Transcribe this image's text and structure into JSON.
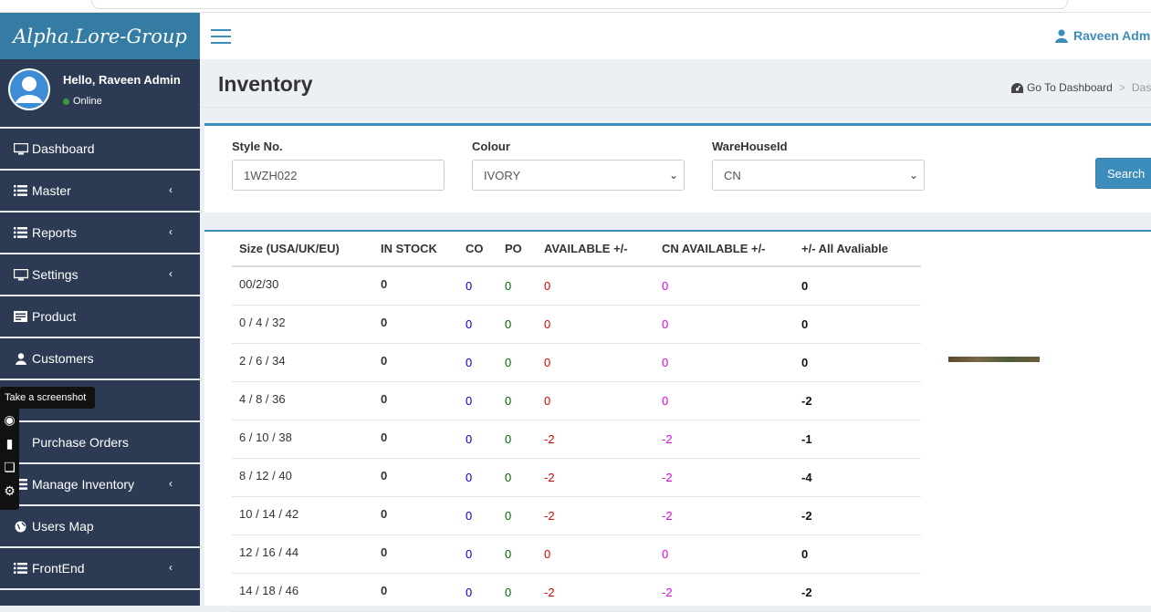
{
  "app": {
    "logo": "Alpha.Lore-Group"
  },
  "user": {
    "greeting": "Hello, Raveen Admin",
    "status": "Online",
    "top_name": "Raveen Admin"
  },
  "sidebar": {
    "items": [
      {
        "label": "Dashboard",
        "icon": "desktop-icon",
        "chevron": false
      },
      {
        "label": "Master",
        "icon": "list-icon",
        "chevron": true
      },
      {
        "label": "Reports",
        "icon": "list-icon",
        "chevron": true
      },
      {
        "label": "Settings",
        "icon": "desktop-icon",
        "chevron": true
      },
      {
        "label": "Product",
        "icon": "product-icon",
        "chevron": false
      },
      {
        "label": "Customers",
        "icon": "user-icon",
        "chevron": false
      },
      {
        "label": "",
        "icon": "",
        "chevron": false
      },
      {
        "label": "Purchase Orders",
        "icon": "",
        "chevron": false
      },
      {
        "label": "Manage Inventory",
        "icon": "list-icon",
        "chevron": true
      },
      {
        "label": "Users Map",
        "icon": "globe-icon",
        "chevron": false
      },
      {
        "label": "FrontEnd",
        "icon": "list-icon",
        "chevron": true
      }
    ]
  },
  "overlay": {
    "tooltip": "Take a screenshot"
  },
  "header": {
    "title": "Inventory",
    "breadcrumb": {
      "dashboard": "Go To Dashboard",
      "current": "Dashb"
    }
  },
  "filters": {
    "style_label": "Style No.",
    "style_value": "1WZH022",
    "colour_label": "Colour",
    "colour_value": "IVORY",
    "warehouse_label": "WareHouseId",
    "warehouse_value": "CN",
    "search_label": "Search"
  },
  "table": {
    "headers": [
      "Size (USA/UK/EU)",
      "IN STOCK",
      "CO",
      "PO",
      "AVAILABLE +/-",
      "CN AVAILABLE +/-",
      "+/- All Avaliable"
    ],
    "rows": [
      {
        "size": "00/2/30",
        "stock": "0",
        "co": "0",
        "po": "0",
        "available": "0",
        "cn": "0",
        "all": "0"
      },
      {
        "size": "0 / 4 / 32",
        "stock": "0",
        "co": "0",
        "po": "0",
        "available": "0",
        "cn": "0",
        "all": "0"
      },
      {
        "size": "2 / 6 / 34",
        "stock": "0",
        "co": "0",
        "po": "0",
        "available": "0",
        "cn": "0",
        "all": "0"
      },
      {
        "size": "4 / 8 / 36",
        "stock": "0",
        "co": "0",
        "po": "0",
        "available": "0",
        "cn": "0",
        "all": "-2"
      },
      {
        "size": "6 / 10 / 38",
        "stock": "0",
        "co": "0",
        "po": "0",
        "available": "-2",
        "cn": "-2",
        "all": "-1"
      },
      {
        "size": "8 / 12 / 40",
        "stock": "0",
        "co": "0",
        "po": "0",
        "available": "-2",
        "cn": "-2",
        "all": "-4"
      },
      {
        "size": "10 / 14 / 42",
        "stock": "0",
        "co": "0",
        "po": "0",
        "available": "-2",
        "cn": "-2",
        "all": "-2"
      },
      {
        "size": "12 / 16 / 44",
        "stock": "0",
        "co": "0",
        "po": "0",
        "available": "0",
        "cn": "0",
        "all": "0"
      },
      {
        "size": "14 / 18 / 46",
        "stock": "0",
        "co": "0",
        "po": "0",
        "available": "-2",
        "cn": "-2",
        "all": "-2"
      }
    ]
  },
  "colors": {
    "accent": "#3c8dbc",
    "sidebar": "#2c3b53",
    "logo_bg": "#357ca5",
    "co": "#0000cc",
    "po": "#006600",
    "available": "#e00000",
    "cn": "#e000e0"
  }
}
